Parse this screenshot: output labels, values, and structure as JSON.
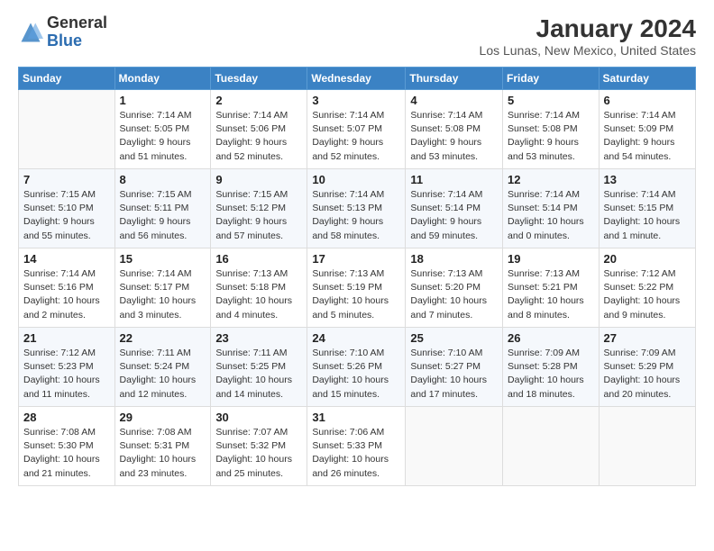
{
  "header": {
    "logo_general": "General",
    "logo_blue": "Blue",
    "month_title": "January 2024",
    "location": "Los Lunas, New Mexico, United States"
  },
  "columns": [
    "Sunday",
    "Monday",
    "Tuesday",
    "Wednesday",
    "Thursday",
    "Friday",
    "Saturday"
  ],
  "weeks": [
    [
      {
        "day": "",
        "sunrise": "",
        "sunset": "",
        "daylight": ""
      },
      {
        "day": "1",
        "sunrise": "Sunrise: 7:14 AM",
        "sunset": "Sunset: 5:05 PM",
        "daylight": "Daylight: 9 hours and 51 minutes."
      },
      {
        "day": "2",
        "sunrise": "Sunrise: 7:14 AM",
        "sunset": "Sunset: 5:06 PM",
        "daylight": "Daylight: 9 hours and 52 minutes."
      },
      {
        "day": "3",
        "sunrise": "Sunrise: 7:14 AM",
        "sunset": "Sunset: 5:07 PM",
        "daylight": "Daylight: 9 hours and 52 minutes."
      },
      {
        "day": "4",
        "sunrise": "Sunrise: 7:14 AM",
        "sunset": "Sunset: 5:08 PM",
        "daylight": "Daylight: 9 hours and 53 minutes."
      },
      {
        "day": "5",
        "sunrise": "Sunrise: 7:14 AM",
        "sunset": "Sunset: 5:08 PM",
        "daylight": "Daylight: 9 hours and 53 minutes."
      },
      {
        "day": "6",
        "sunrise": "Sunrise: 7:14 AM",
        "sunset": "Sunset: 5:09 PM",
        "daylight": "Daylight: 9 hours and 54 minutes."
      }
    ],
    [
      {
        "day": "7",
        "sunrise": "Sunrise: 7:15 AM",
        "sunset": "Sunset: 5:10 PM",
        "daylight": "Daylight: 9 hours and 55 minutes."
      },
      {
        "day": "8",
        "sunrise": "Sunrise: 7:15 AM",
        "sunset": "Sunset: 5:11 PM",
        "daylight": "Daylight: 9 hours and 56 minutes."
      },
      {
        "day": "9",
        "sunrise": "Sunrise: 7:15 AM",
        "sunset": "Sunset: 5:12 PM",
        "daylight": "Daylight: 9 hours and 57 minutes."
      },
      {
        "day": "10",
        "sunrise": "Sunrise: 7:14 AM",
        "sunset": "Sunset: 5:13 PM",
        "daylight": "Daylight: 9 hours and 58 minutes."
      },
      {
        "day": "11",
        "sunrise": "Sunrise: 7:14 AM",
        "sunset": "Sunset: 5:14 PM",
        "daylight": "Daylight: 9 hours and 59 minutes."
      },
      {
        "day": "12",
        "sunrise": "Sunrise: 7:14 AM",
        "sunset": "Sunset: 5:14 PM",
        "daylight": "Daylight: 10 hours and 0 minutes."
      },
      {
        "day": "13",
        "sunrise": "Sunrise: 7:14 AM",
        "sunset": "Sunset: 5:15 PM",
        "daylight": "Daylight: 10 hours and 1 minute."
      }
    ],
    [
      {
        "day": "14",
        "sunrise": "Sunrise: 7:14 AM",
        "sunset": "Sunset: 5:16 PM",
        "daylight": "Daylight: 10 hours and 2 minutes."
      },
      {
        "day": "15",
        "sunrise": "Sunrise: 7:14 AM",
        "sunset": "Sunset: 5:17 PM",
        "daylight": "Daylight: 10 hours and 3 minutes."
      },
      {
        "day": "16",
        "sunrise": "Sunrise: 7:13 AM",
        "sunset": "Sunset: 5:18 PM",
        "daylight": "Daylight: 10 hours and 4 minutes."
      },
      {
        "day": "17",
        "sunrise": "Sunrise: 7:13 AM",
        "sunset": "Sunset: 5:19 PM",
        "daylight": "Daylight: 10 hours and 5 minutes."
      },
      {
        "day": "18",
        "sunrise": "Sunrise: 7:13 AM",
        "sunset": "Sunset: 5:20 PM",
        "daylight": "Daylight: 10 hours and 7 minutes."
      },
      {
        "day": "19",
        "sunrise": "Sunrise: 7:13 AM",
        "sunset": "Sunset: 5:21 PM",
        "daylight": "Daylight: 10 hours and 8 minutes."
      },
      {
        "day": "20",
        "sunrise": "Sunrise: 7:12 AM",
        "sunset": "Sunset: 5:22 PM",
        "daylight": "Daylight: 10 hours and 9 minutes."
      }
    ],
    [
      {
        "day": "21",
        "sunrise": "Sunrise: 7:12 AM",
        "sunset": "Sunset: 5:23 PM",
        "daylight": "Daylight: 10 hours and 11 minutes."
      },
      {
        "day": "22",
        "sunrise": "Sunrise: 7:11 AM",
        "sunset": "Sunset: 5:24 PM",
        "daylight": "Daylight: 10 hours and 12 minutes."
      },
      {
        "day": "23",
        "sunrise": "Sunrise: 7:11 AM",
        "sunset": "Sunset: 5:25 PM",
        "daylight": "Daylight: 10 hours and 14 minutes."
      },
      {
        "day": "24",
        "sunrise": "Sunrise: 7:10 AM",
        "sunset": "Sunset: 5:26 PM",
        "daylight": "Daylight: 10 hours and 15 minutes."
      },
      {
        "day": "25",
        "sunrise": "Sunrise: 7:10 AM",
        "sunset": "Sunset: 5:27 PM",
        "daylight": "Daylight: 10 hours and 17 minutes."
      },
      {
        "day": "26",
        "sunrise": "Sunrise: 7:09 AM",
        "sunset": "Sunset: 5:28 PM",
        "daylight": "Daylight: 10 hours and 18 minutes."
      },
      {
        "day": "27",
        "sunrise": "Sunrise: 7:09 AM",
        "sunset": "Sunset: 5:29 PM",
        "daylight": "Daylight: 10 hours and 20 minutes."
      }
    ],
    [
      {
        "day": "28",
        "sunrise": "Sunrise: 7:08 AM",
        "sunset": "Sunset: 5:30 PM",
        "daylight": "Daylight: 10 hours and 21 minutes."
      },
      {
        "day": "29",
        "sunrise": "Sunrise: 7:08 AM",
        "sunset": "Sunset: 5:31 PM",
        "daylight": "Daylight: 10 hours and 23 minutes."
      },
      {
        "day": "30",
        "sunrise": "Sunrise: 7:07 AM",
        "sunset": "Sunset: 5:32 PM",
        "daylight": "Daylight: 10 hours and 25 minutes."
      },
      {
        "day": "31",
        "sunrise": "Sunrise: 7:06 AM",
        "sunset": "Sunset: 5:33 PM",
        "daylight": "Daylight: 10 hours and 26 minutes."
      },
      {
        "day": "",
        "sunrise": "",
        "sunset": "",
        "daylight": ""
      },
      {
        "day": "",
        "sunrise": "",
        "sunset": "",
        "daylight": ""
      },
      {
        "day": "",
        "sunrise": "",
        "sunset": "",
        "daylight": ""
      }
    ]
  ]
}
